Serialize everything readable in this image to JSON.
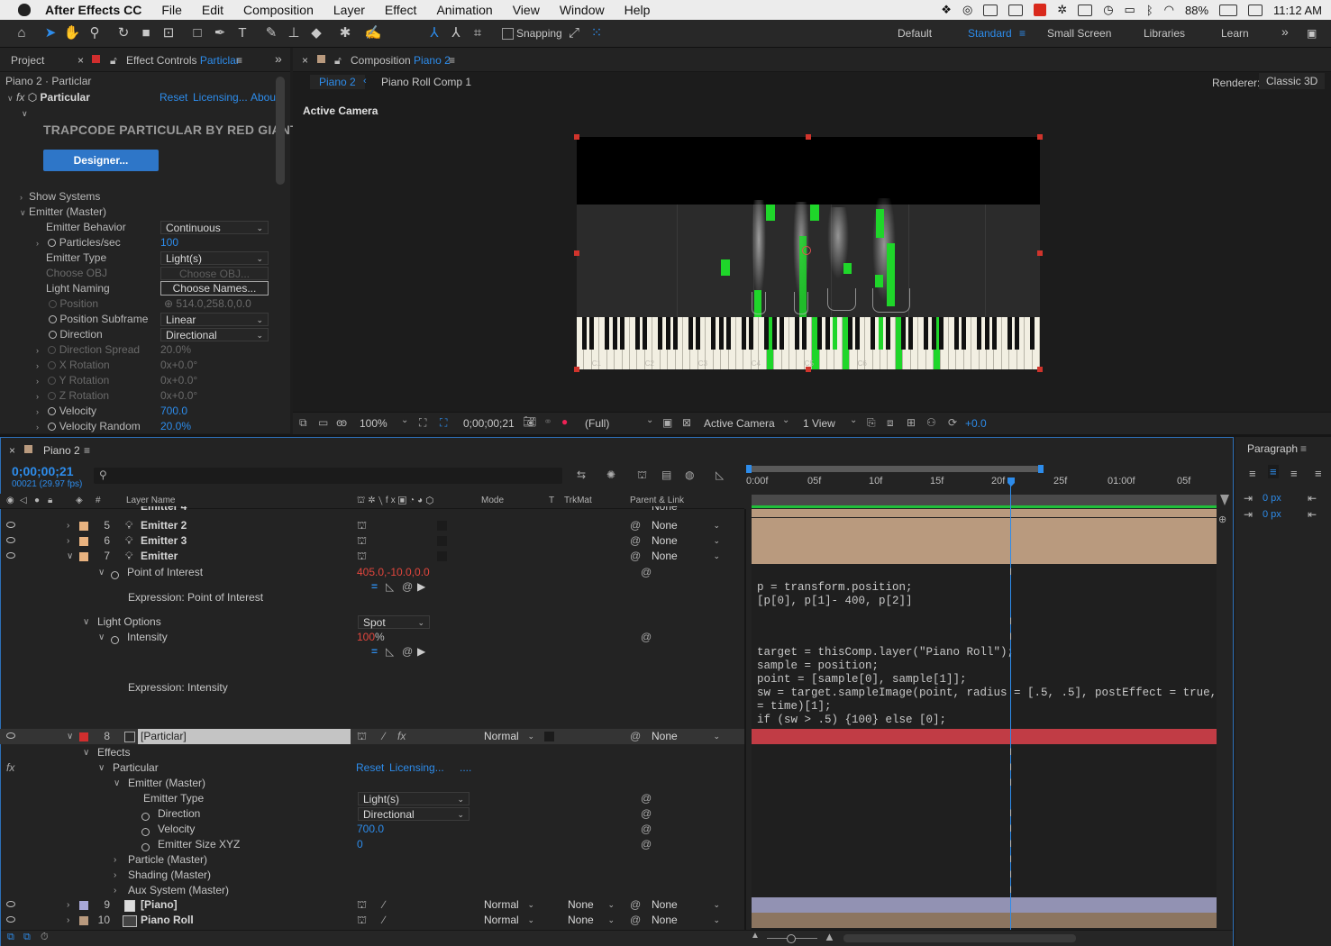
{
  "menubar": {
    "app_name": "After Effects CC",
    "items": [
      "File",
      "Edit",
      "Composition",
      "Layer",
      "Effect",
      "Animation",
      "View",
      "Window",
      "Help"
    ],
    "battery": "88%",
    "time": "11:12 AM"
  },
  "toolbar": {
    "snapping_label": "Snapping",
    "workspaces": [
      "Default",
      "Standard",
      "Small Screen",
      "Libraries",
      "Learn"
    ],
    "active_workspace": "Standard"
  },
  "effect_controls": {
    "tab_project": "Project",
    "tab_effect_controls": "Effect Controls",
    "tab_effect_target": "Particlar",
    "layer_path": "Piano 2 · Particlar",
    "effect_name": "Particular",
    "reset_label": "Reset",
    "licensing_label": "Licensing...",
    "about_label": "Abou",
    "banner": "TRAPCODE PARTICULAR BY RED GIANT",
    "designer_button": "Designer...",
    "show_systems": "Show Systems",
    "emitter_master": "Emitter (Master)",
    "props": {
      "emitter_behavior_label": "Emitter Behavior",
      "emitter_behavior_value": "Continuous",
      "particles_sec_label": "Particles/sec",
      "particles_sec_value": "100",
      "emitter_type_label": "Emitter Type",
      "emitter_type_value": "Light(s)",
      "choose_obj_label": "Choose OBJ",
      "choose_obj_button": "Choose OBJ...",
      "light_naming_label": "Light Naming",
      "choose_names_button": "Choose Names...",
      "position_label": "Position",
      "position_value": "514.0,258.0,0.0",
      "position_subframe_label": "Position Subframe",
      "position_subframe_value": "Linear",
      "direction_label": "Direction",
      "direction_value": "Directional",
      "direction_spread_label": "Direction Spread",
      "direction_spread_value": "20.0%",
      "x_rotation_label": "X Rotation",
      "x_rotation_value": "0x+0.0°",
      "y_rotation_label": "Y Rotation",
      "y_rotation_value": "0x+0.0°",
      "z_rotation_label": "Z Rotation",
      "z_rotation_value": "0x+0.0°",
      "velocity_label": "Velocity",
      "velocity_value": "700.0",
      "velocity_random_label": "Velocity Random",
      "velocity_random_value": "20.0%"
    }
  },
  "composition": {
    "tab_label": "Composition",
    "tab_target": "Piano 2",
    "breadcrumb_active": "Piano 2",
    "breadcrumb_next": "Piano Roll Comp 1",
    "renderer_label": "Renderer:",
    "renderer_value": "Classic 3D",
    "view_label": "Active Camera",
    "key_labels": [
      "C1",
      "C2",
      "C3",
      "C4",
      "C5",
      "C6"
    ],
    "footer": {
      "zoom": "100%",
      "timecode": "0;00;00;21",
      "resolution": "(Full)",
      "camera": "Active Camera",
      "views": "1 View",
      "exposure": "+0.0"
    }
  },
  "paragraph": {
    "title": "Paragraph",
    "indent_left": "0 px",
    "indent_first": "0 px"
  },
  "timeline": {
    "tab": "Piano 2",
    "timecode": "0;00;00;21",
    "frame_info": "00021 (29.97 fps)",
    "ruler_labels": [
      "0:00f",
      "05f",
      "10f",
      "15f",
      "20f",
      "25f",
      "01:00f",
      "05f"
    ],
    "columns": {
      "layer_name": "Layer Name",
      "mode": "Mode",
      "t": "T",
      "trkmat": "TrkMat",
      "parent": "Parent & Link"
    },
    "emitter_rows": [
      {
        "num": "5",
        "name": "Emitter 2",
        "parent": "None"
      },
      {
        "num": "6",
        "name": "Emitter 3",
        "parent": "None"
      },
      {
        "num": "7",
        "name": "Emitter",
        "parent": "None"
      }
    ],
    "partial_row_name": "Emitter 4",
    "point_of_interest_label": "Point of Interest",
    "point_of_interest_value": "405.0,-10.0,0.0",
    "expr_poi_label": "Expression: Point of Interest",
    "expr_poi_code": "p = transform.position;\n[p[0], p[1]- 400, p[2]]",
    "light_options_label": "Light Options",
    "light_options_value": "Spot",
    "intensity_label": "Intensity",
    "intensity_value": "100",
    "intensity_unit": "%",
    "expr_intensity_label": "Expression: Intensity",
    "expr_intensity_code": "target = thisComp.layer(\"Piano Roll\");\nsample = position;\npoint = [sample[0], sample[1]];\nsw = target.sampleImage(point, radius = [.5, .5], postEffect = true, t\n= time)[1];\nif (sw > .5) {100} else [0];",
    "particlar_row": {
      "num": "8",
      "name": "[Particlar]",
      "mode": "Normal",
      "parent": "None"
    },
    "effects_label": "Effects",
    "particular_label": "Particular",
    "reset_label": "Reset",
    "licensing_label": "Licensing...",
    "ellipsis": "....",
    "emitter_master_label": "Emitter (Master)",
    "emitter_type_label": "Emitter Type",
    "emitter_type_value": "Light(s)",
    "direction_label": "Direction",
    "direction_value": "Directional",
    "velocity_label": "Velocity",
    "velocity_value": "700.0",
    "emitter_size_label": "Emitter Size XYZ",
    "emitter_size_value": "0",
    "particle_master_label": "Particle (Master)",
    "shading_master_label": "Shading (Master)",
    "aux_master_label": "Aux System (Master)",
    "bottom_rows": [
      {
        "num": "9",
        "name": "[Piano]",
        "mode": "Normal",
        "trkmat": "None",
        "parent": "None"
      },
      {
        "num": "10",
        "name": "Piano Roll",
        "mode": "Normal",
        "trkmat": "None",
        "parent": "None"
      }
    ]
  },
  "colors": {
    "accent_blue": "#2d8ceb",
    "emitter_bar": "#b99a7e",
    "particlar_bar": "#c13c45",
    "piano_bar": "#9292b3",
    "note_green": "#1fd62a",
    "stopwatch_value_red": "#e2463d"
  }
}
